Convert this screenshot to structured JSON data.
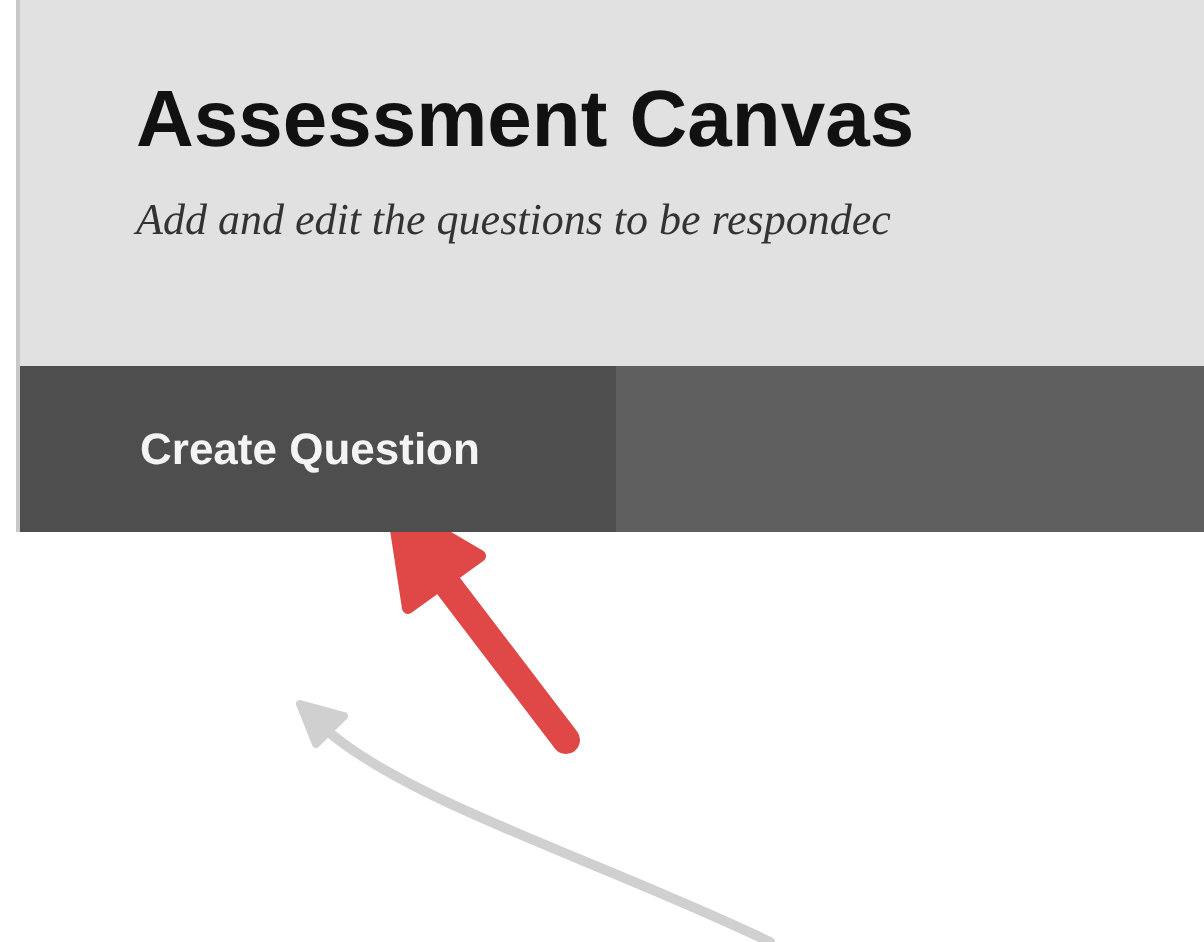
{
  "header": {
    "title": "Assessment Canvas",
    "subtitle": "Add and edit the questions to be respondec"
  },
  "toolbar": {
    "buttons": [
      {
        "label": "Create Question"
      }
    ]
  }
}
